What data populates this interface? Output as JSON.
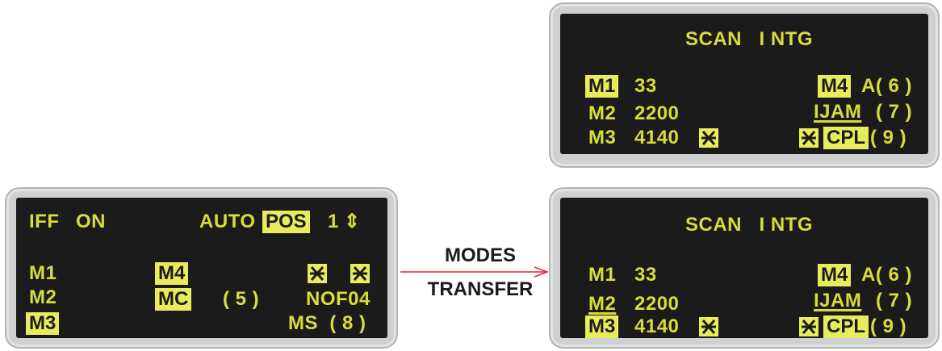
{
  "left_panel": {
    "iff": "IFF",
    "on": "ON",
    "auto": "AUTO",
    "pos": "POS",
    "pos_num": "1",
    "updown": "⇕",
    "m1": "M1",
    "m2": "M2",
    "m3": "M3",
    "m4": "M4",
    "mc": "MC",
    "paren5": "( 5 )",
    "nof": "NOF04",
    "ms": "MS  ( 8 )"
  },
  "transfer": {
    "line1": "MODES",
    "line2": "TRANSFER",
    "arrow_color": "#e0242b"
  },
  "top_right_panel": {
    "title": "SCAN   I NTG",
    "m1": "M1",
    "m1_val": "33",
    "m2": "M2",
    "m2_val": "2200",
    "m3": "M3",
    "m3_val": "4140",
    "m4": "M4",
    "a6": "A( 6 )",
    "ijam": "IJAM",
    "p7": "( 7 )",
    "cpl": "CPL",
    "p9": "( 9 )"
  },
  "bottom_right_panel": {
    "title": "SCAN   I NTG",
    "m1": "M1",
    "m1_val": "33",
    "m2": "M2",
    "m2_val": "2200",
    "m3": "M3",
    "m3_val": "4140",
    "m4": "M4",
    "a6": "A( 6 )",
    "ijam": "IJAM",
    "p7": "( 7 )",
    "cpl": "CPL",
    "p9": "( 9 )"
  },
  "colors": {
    "text": "#d8dc3a",
    "highlight": "#e9ec5a",
    "screen": "#1b1b1b",
    "bezel": "#cfd0d1"
  }
}
